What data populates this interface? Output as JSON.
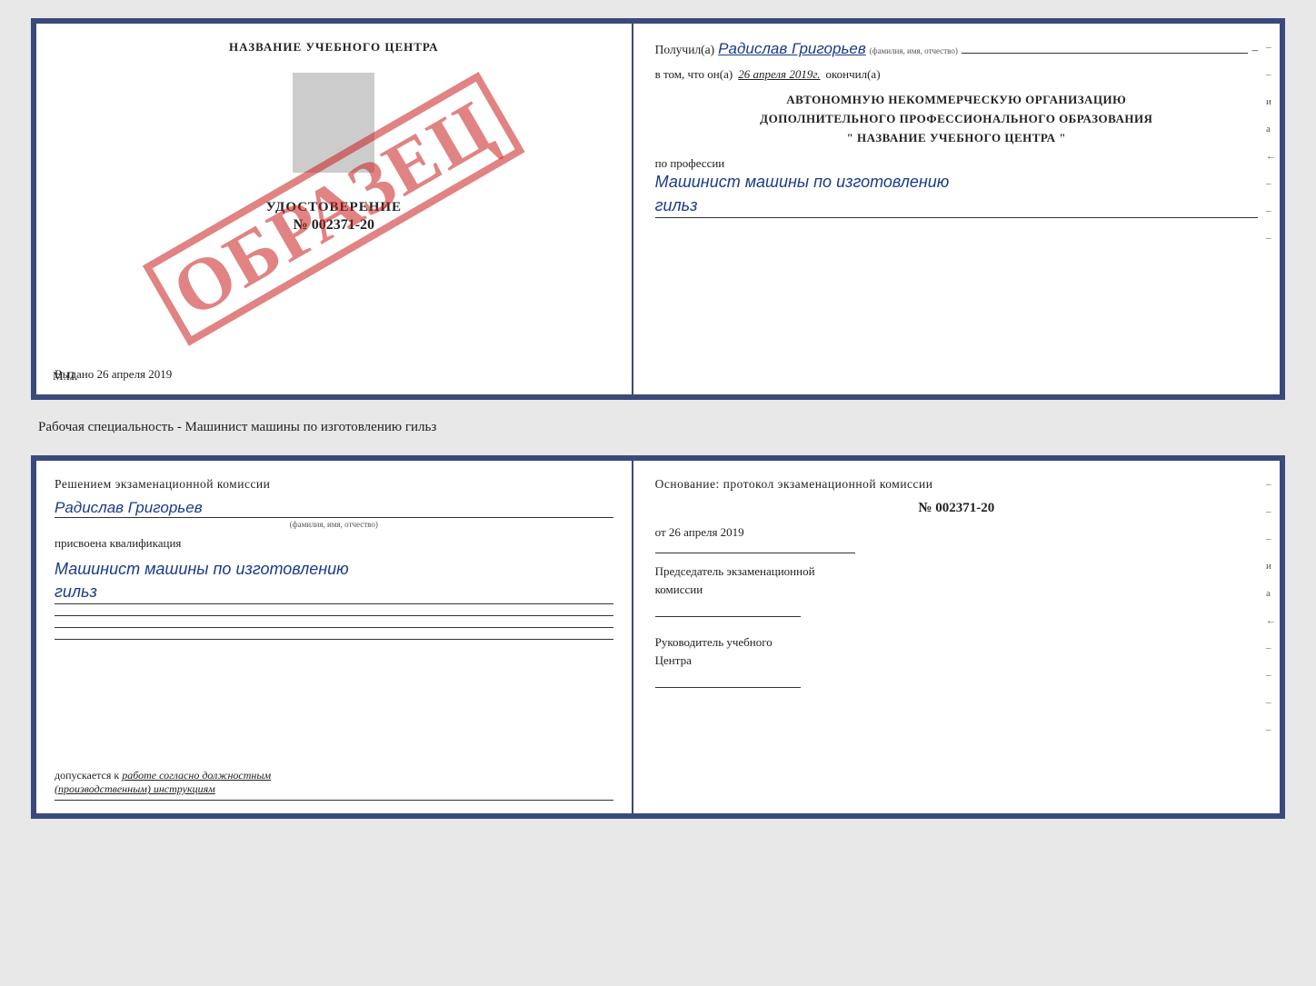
{
  "topCert": {
    "left": {
      "schoolName": "НАЗВАНИЕ УЧЕБНОГО ЦЕНТРА",
      "obrazec": "ОБРАЗЕЦ",
      "udostoverenie": {
        "title": "УДОСТОВЕРЕНИЕ",
        "number": "№ 002371-20"
      },
      "vydano": "Выдано 26 апреля 2019",
      "mp": "М.П."
    },
    "right": {
      "poluchilLabel": "Получил(а)",
      "recipientName": "Радислав Григорьев",
      "fioLabel": "(фамилия, имя, отчество)",
      "vtomChtoOn": "в том, что он(а)",
      "date": "26 апреля 2019г.",
      "okonchil": "окончил(а)",
      "line1": "АВТОНОМНУЮ НЕКОММЕРЧЕСКУЮ ОРГАНИЗАЦИЮ",
      "line2": "ДОПОЛНИТЕЛЬНОГО ПРОФЕССИОНАЛЬНОГО ОБРАЗОВАНИЯ",
      "line3": "\"   НАЗВАНИЕ УЧЕБНОГО ЦЕНТРА   \"",
      "poProfessii": "по профессии",
      "profession1": "Машинист машины по изготовлению",
      "profession2": "гильз",
      "sideMarks": [
        "–",
        "–",
        "и",
        "а",
        "←",
        "–",
        "–",
        "–"
      ]
    }
  },
  "middleText": "Рабочая специальность - Машинист машины по изготовлению гильз",
  "bottomCert": {
    "left": {
      "resheniem": "Решением  экзаменационной  комиссии",
      "recipientName": "Радислав Григорьев",
      "fioLabel": "(фамилия, имя, отчество)",
      "prisvoena": "присвоена квалификация",
      "kvali1": "Машинист  машины  по  изготовлению",
      "kvali2": "гильз",
      "dopusk1": "допускается к",
      "dopusk2": "работе согласно должностным",
      "dopusk3": "(производственным) инструкциям"
    },
    "right": {
      "osnovanie": "Основание: протокол экзаменационной  комиссии",
      "number": "№  002371-20",
      "datePrefix": "от",
      "date": "26 апреля 2019",
      "predsedatelLabel": "Председатель экзаменационной",
      "predsedatelLabel2": "комиссии",
      "rukovoditelLabel": "Руководитель учебного",
      "tsentraLabel": "Центра",
      "sideMarks": [
        "–",
        "–",
        "–",
        "и",
        "а",
        "←",
        "–",
        "–",
        "–",
        "–"
      ]
    }
  }
}
